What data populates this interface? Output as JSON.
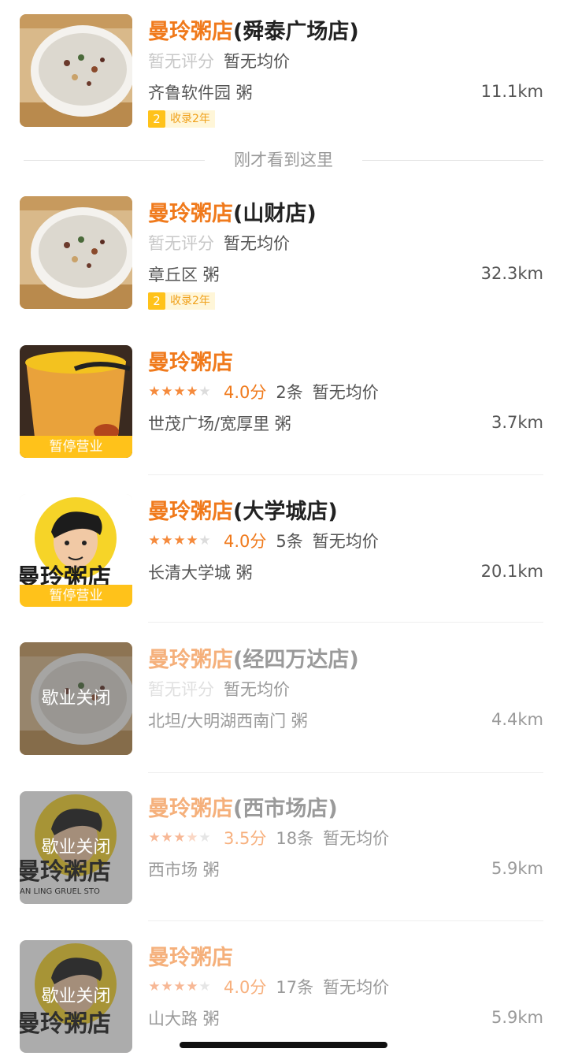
{
  "seen_here_label": "刚才看到这里",
  "stores": [
    {
      "brand": "曼玲粥店",
      "branch": "(舜泰广场店)",
      "no_score": "暂无评分",
      "avg": "暂无均价",
      "area": "齐鲁软件园 粥",
      "distance": "11.1km",
      "badge_num": "2",
      "badge_text": "收录2年"
    },
    {
      "brand": "曼玲粥店",
      "branch": "(山财店)",
      "no_score": "暂无评分",
      "avg": "暂无均价",
      "area": "章丘区 粥",
      "distance": "32.3km",
      "badge_num": "2",
      "badge_text": "收录2年"
    },
    {
      "brand": "曼玲粥店",
      "branch": "",
      "rating": 4.0,
      "score": "4.0分",
      "count": "2条",
      "avg": "暂无均价",
      "area": "世茂广场/宽厚里 粥",
      "distance": "3.7km",
      "status": "暂停营业"
    },
    {
      "brand": "曼玲粥店",
      "branch": "(大学城店)",
      "rating": 4.0,
      "score": "4.0分",
      "count": "5条",
      "avg": "暂无均价",
      "area": "长清大学城 粥",
      "distance": "20.1km",
      "status": "暂停营业"
    },
    {
      "brand": "曼玲粥店",
      "branch": "(经四万达店)",
      "no_score": "暂无评分",
      "avg": "暂无均价",
      "area": "北坦/大明湖西南门 粥",
      "distance": "4.4km",
      "status": "歇业关闭"
    },
    {
      "brand": "曼玲粥店",
      "branch": "(西市场店)",
      "rating": 3.5,
      "score": "3.5分",
      "count": "18条",
      "avg": "暂无均价",
      "area": "西市场 粥",
      "distance": "5.9km",
      "status": "歇业关闭"
    },
    {
      "brand": "曼玲粥店",
      "branch": "",
      "rating": 4.0,
      "score": "4.0分",
      "count": "17条",
      "avg": "暂无均价",
      "area": "山大路 粥",
      "distance": "5.9km",
      "status": "歇业关闭"
    }
  ],
  "logo_text": "曼玲粥店",
  "logo_subtext": "AN LING  GRUEL STO",
  "colors": {
    "brand_orange": "#f07a1c",
    "pause_yellow": "#ffc21a",
    "star_orange": "#f58a3c"
  }
}
